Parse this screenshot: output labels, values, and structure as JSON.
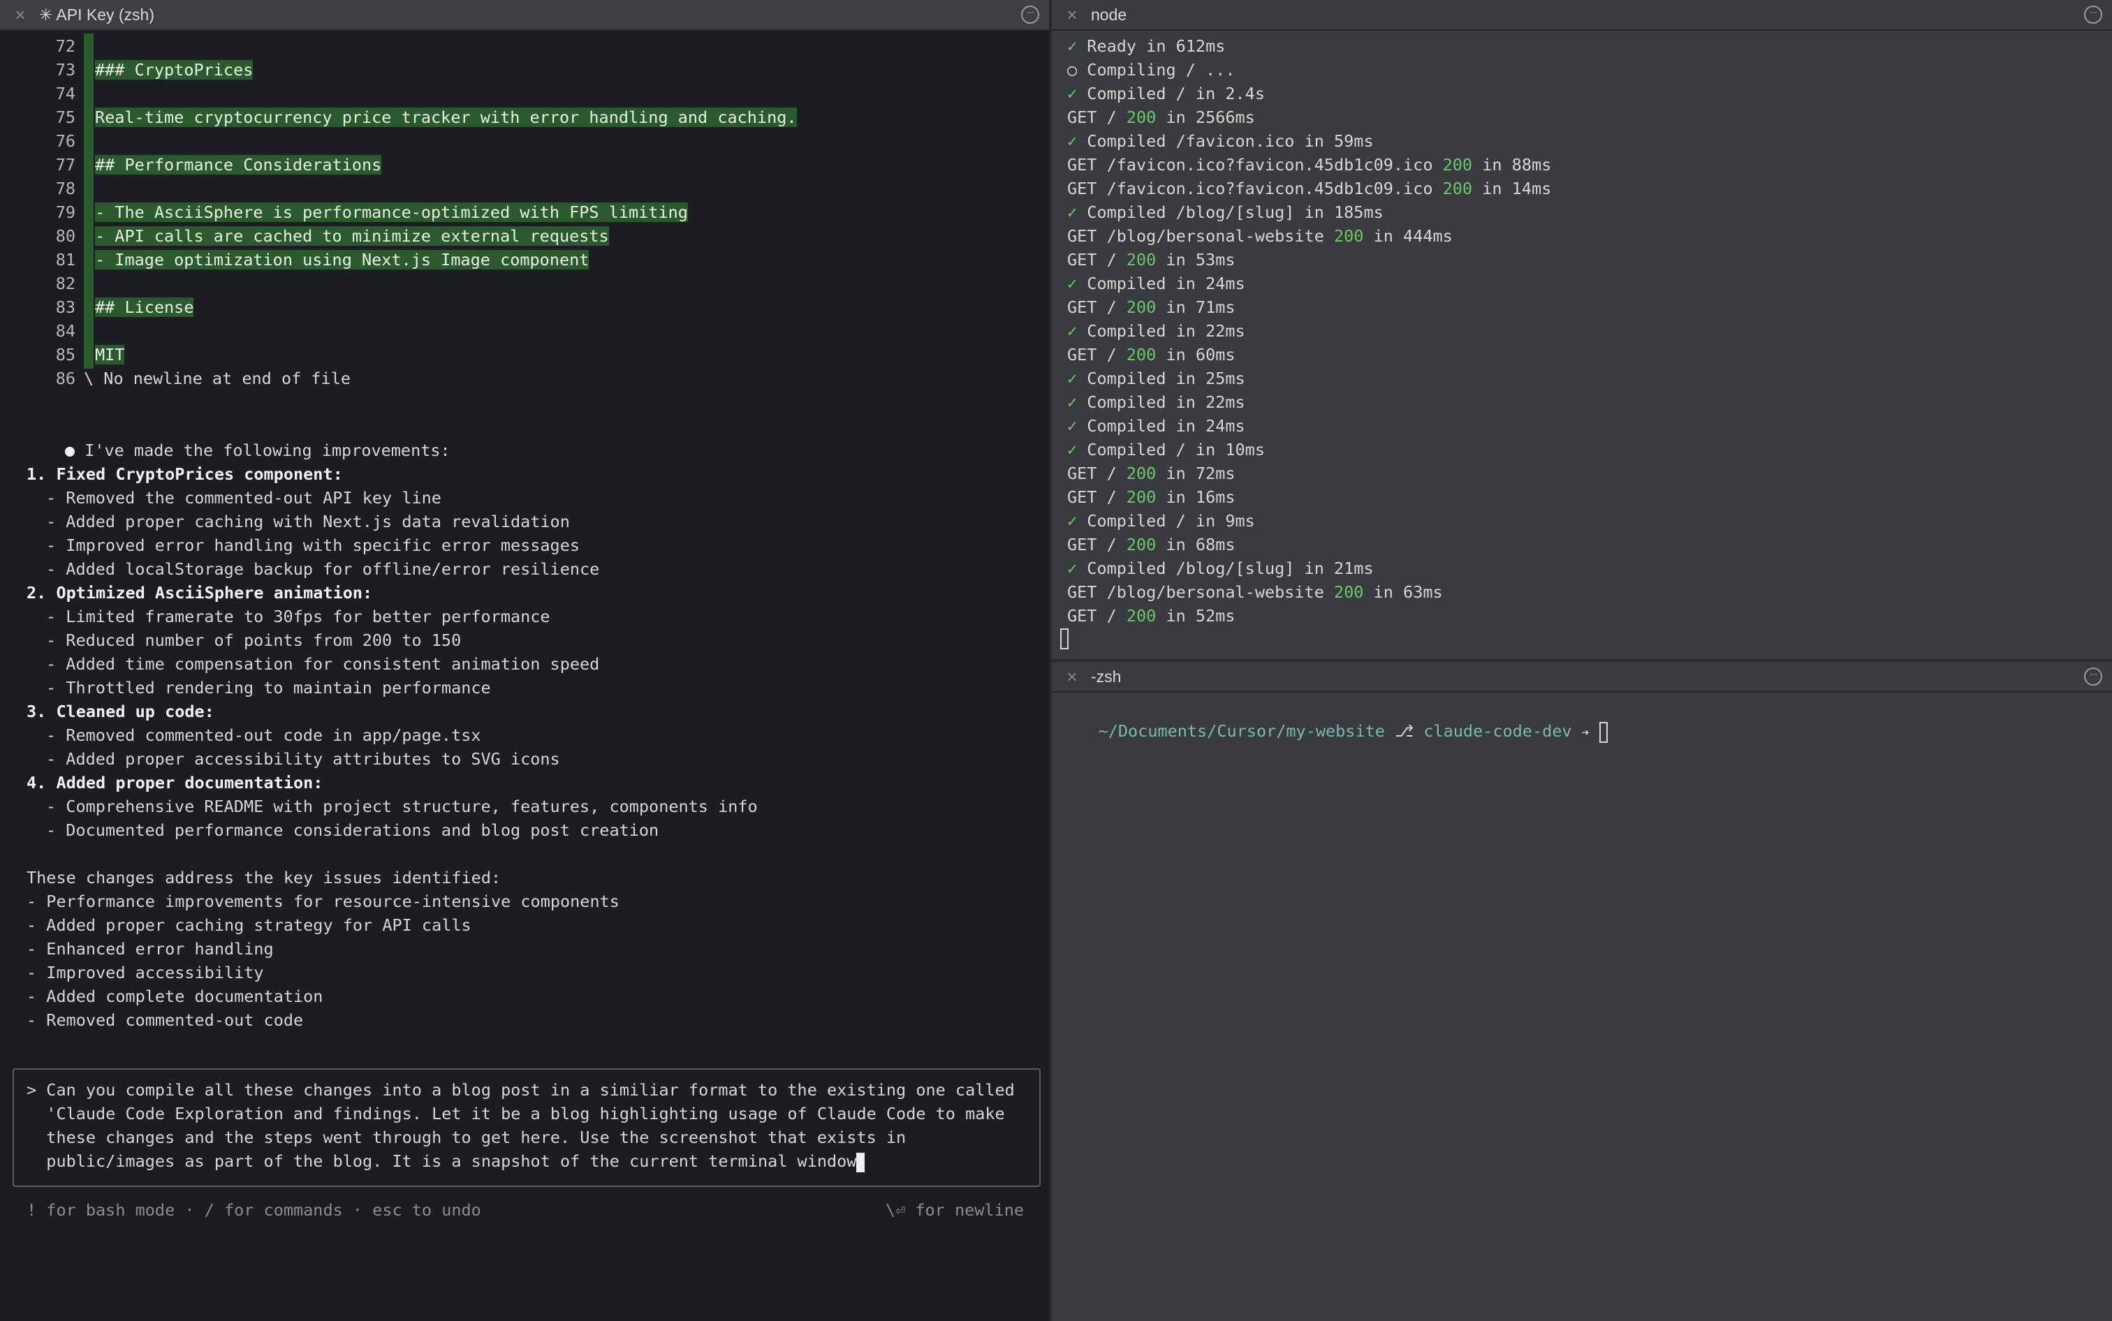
{
  "left_pane": {
    "tab_title": "✳ API Key (zsh)",
    "diff_lines": [
      {
        "num": "72",
        "text": "",
        "hl": false
      },
      {
        "num": "73",
        "text": "### CryptoPrices",
        "hl": true
      },
      {
        "num": "74",
        "text": "",
        "hl": false
      },
      {
        "num": "75",
        "text": "Real-time cryptocurrency price tracker with error handling and caching.",
        "hl": true
      },
      {
        "num": "76",
        "text": "",
        "hl": false
      },
      {
        "num": "77",
        "text": "## Performance Considerations",
        "hl": true
      },
      {
        "num": "78",
        "text": "",
        "hl": false
      },
      {
        "num": "79",
        "text": "- The AsciiSphere is performance-optimized with FPS limiting",
        "hl": true
      },
      {
        "num": "80",
        "text": "- API calls are cached to minimize external requests",
        "hl": true
      },
      {
        "num": "81",
        "text": "- Image optimization using Next.js Image component",
        "hl": true
      },
      {
        "num": "82",
        "text": "",
        "hl": false
      },
      {
        "num": "83",
        "text": "## License",
        "hl": true
      },
      {
        "num": "84",
        "text": "",
        "hl": false
      },
      {
        "num": "85",
        "text": "MIT",
        "hl": true
      },
      {
        "num": "86",
        "text": "\\ No newline at end of file",
        "hl": false
      }
    ],
    "summary_intro": "I've made the following improvements:",
    "sections": [
      {
        "title": "1. Fixed CryptoPrices component:",
        "items": [
          "- Removed the commented-out API key line",
          "- Added proper caching with Next.js data revalidation",
          "- Improved error handling with specific error messages",
          "- Added localStorage backup for offline/error resilience"
        ]
      },
      {
        "title": "2. Optimized AsciiSphere animation:",
        "items": [
          "- Limited framerate to 30fps for better performance",
          "- Reduced number of points from 200 to 150",
          "- Added time compensation for consistent animation speed",
          "- Throttled rendering to maintain performance"
        ]
      },
      {
        "title": "3. Cleaned up code:",
        "items": [
          "- Removed commented-out code in app/page.tsx",
          "- Added proper accessibility attributes to SVG icons"
        ]
      },
      {
        "title": "4. Added proper documentation:",
        "items": [
          "- Comprehensive README with project structure, features, components info",
          "- Documented performance considerations and blog post creation"
        ]
      }
    ],
    "changes_intro": "These changes address the key issues identified:",
    "changes": [
      "- Performance improvements for resource-intensive components",
      "- Added proper caching strategy for API calls",
      "- Enhanced error handling",
      "- Improved accessibility",
      "- Added complete documentation",
      "- Removed commented-out code"
    ],
    "prompt_lines": [
      "Can you compile all these changes into a blog post in a similiar format to the existing one called",
      "'Claude Code Exploration and findings. Let it be a blog highlighting usage of Claude Code to make",
      "these changes and the steps went through to get here. Use the screenshot that exists in",
      "public/images as part of the blog. It is a snapshot of the current terminal window"
    ],
    "hint_left": "! for bash mode · / for commands · esc to undo",
    "hint_right": "\\⏎ for newline"
  },
  "node_pane": {
    "tab_title": "node",
    "log": [
      {
        "pre": "✓ ",
        "text": "Ready in 612ms"
      },
      {
        "pre": "○ ",
        "text": "Compiling / ..."
      },
      {
        "pre": "✓ ",
        "text": "Compiled / in 2.4s"
      },
      {
        "get": "GET / ",
        "code": "200",
        "post": " in 2566ms"
      },
      {
        "pre": "✓ ",
        "text": "Compiled /favicon.ico in 59ms"
      },
      {
        "get": "GET /favicon.ico?favicon.45db1c09.ico ",
        "code": "200",
        "post": " in 88ms"
      },
      {
        "get": "GET /favicon.ico?favicon.45db1c09.ico ",
        "code": "200",
        "post": " in 14ms"
      },
      {
        "pre": "✓ ",
        "text": "Compiled /blog/[slug] in 185ms"
      },
      {
        "get": "GET /blog/bersonal-website ",
        "code": "200",
        "post": " in 444ms"
      },
      {
        "get": "GET / ",
        "code": "200",
        "post": " in 53ms"
      },
      {
        "pre": "✓ ",
        "text": "Compiled in 24ms"
      },
      {
        "get": "GET / ",
        "code": "200",
        "post": " in 71ms"
      },
      {
        "pre": "✓ ",
        "text": "Compiled in 22ms"
      },
      {
        "get": "GET / ",
        "code": "200",
        "post": " in 60ms"
      },
      {
        "pre": "✓ ",
        "text": "Compiled in 25ms"
      },
      {
        "pre": "✓ ",
        "text": "Compiled in 22ms"
      },
      {
        "pre": "✓ ",
        "text": "Compiled in 24ms"
      },
      {
        "pre": "✓ ",
        "text": "Compiled / in 10ms"
      },
      {
        "get": "GET / ",
        "code": "200",
        "post": " in 72ms"
      },
      {
        "get": "GET / ",
        "code": "200",
        "post": " in 16ms"
      },
      {
        "pre": "✓ ",
        "text": "Compiled / in 9ms"
      },
      {
        "get": "GET / ",
        "code": "200",
        "post": " in 68ms"
      },
      {
        "pre": "✓ ",
        "text": "Compiled /blog/[slug] in 21ms"
      },
      {
        "get": "GET /blog/bersonal-website ",
        "code": "200",
        "post": " in 63ms"
      },
      {
        "get": "GET / ",
        "code": "200",
        "post": " in 52ms"
      }
    ]
  },
  "zsh_pane": {
    "tab_title": "-zsh",
    "prompt_path": "~/Documents/Cursor/my-website",
    "prompt_branch_icon": "⎇",
    "prompt_branch": "claude-code-dev",
    "prompt_arrow": "➔"
  },
  "colors": {
    "left_bg": "#1c1d22",
    "right_bg": "#3a3b3f",
    "diff_highlight": "#2b5a2e",
    "success_green": "#6dc76e",
    "prompt_cyan": "#78b9b0"
  }
}
